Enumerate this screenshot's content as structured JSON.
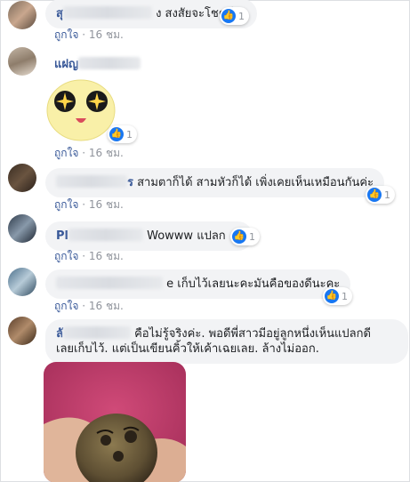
{
  "comments": [
    {
      "name": "สุ",
      "text": "ง สงสัยจะโชคดี",
      "like": "ถูกใจ",
      "time": "16 ชม.",
      "reactions": "1"
    },
    {
      "name": "แฝญ",
      "like": "ถูกใจ",
      "time": "16 ชม.",
      "reactions": "1"
    },
    {
      "name": "ร",
      "text": "สามตาก็ได้ สามหัวก็ได้ เพิ่งเคยเห็นเหมือนกันค่ะ",
      "like": "ถูกใจ",
      "time": "16 ชม.",
      "reactions": "1"
    },
    {
      "name": "Pl",
      "text": "Wowww แปลก",
      "like": "ถูกใจ",
      "time": "16 ชม.",
      "reactions": "1"
    },
    {
      "name": "",
      "text": "e เก็บไว้เลยนะคะมันคือของดีนะคะ",
      "like": "ถูกใจ",
      "time": "16 ชม.",
      "reactions": "1"
    },
    {
      "name": "ลั",
      "line1": "คือไม่รู้จริงค่ะ. พอดีพี่สาวมีอยู่ลูกหนึ่งเห็นแปลกดี",
      "line2": "เลยเก็บไว้. แต่เป็นเขียนคิ้วให้เค้าเฉยเลย. ล้างไม่ออก."
    }
  ],
  "colors": {
    "bubble": "#f2f3f5",
    "link": "#385898",
    "meta": "#90949c",
    "like_icon": "#1877f2"
  },
  "icons": [
    "thumbs-up-icon",
    "laughing-sticker-icon",
    "coconut-photo"
  ]
}
